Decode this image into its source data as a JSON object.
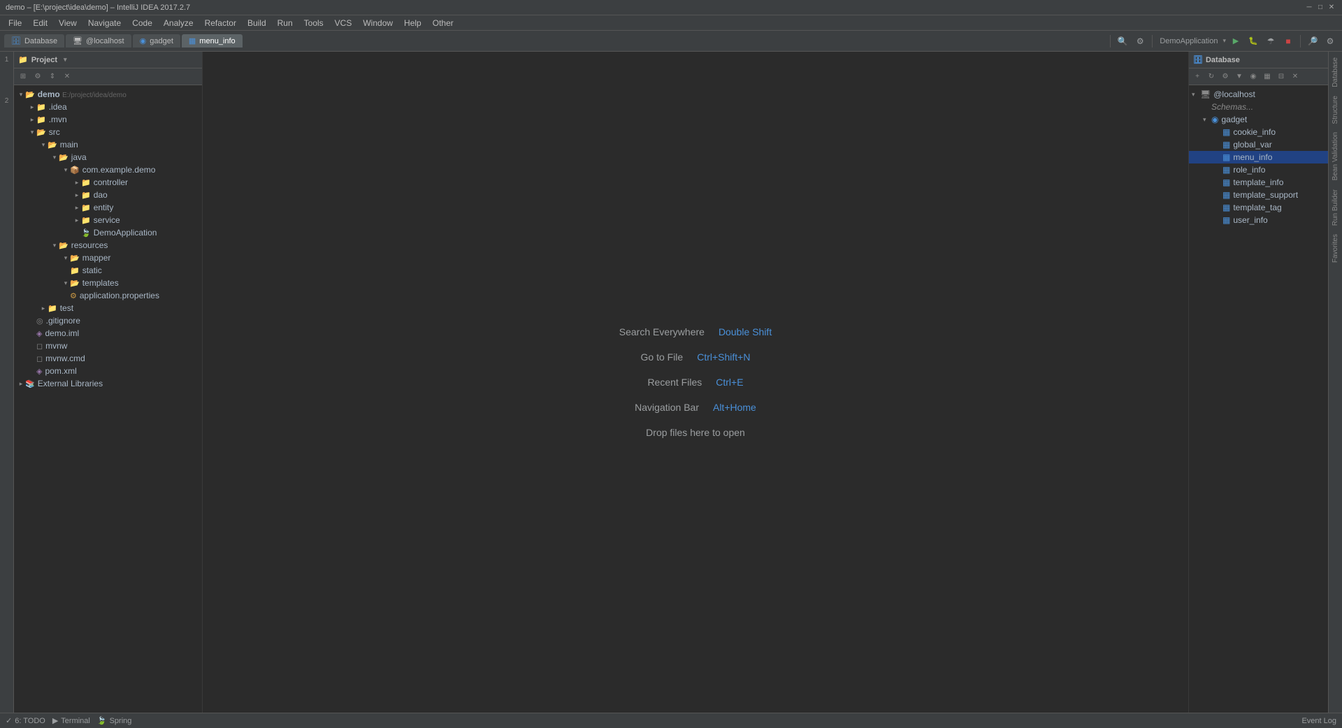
{
  "window": {
    "title": "demo – [E:\\project\\idea\\demo] – IntelliJ IDEA 2017.2.7",
    "controls": [
      "minimize",
      "maximize",
      "close"
    ]
  },
  "menu": {
    "items": [
      "File",
      "Edit",
      "View",
      "Navigate",
      "Code",
      "Analyze",
      "Refactor",
      "Build",
      "Run",
      "Tools",
      "VCS",
      "Window",
      "Help",
      "Other"
    ]
  },
  "tabs": [
    {
      "label": "Database",
      "icon": "db"
    },
    {
      "label": "@localhost",
      "icon": "server"
    },
    {
      "label": "gadget",
      "icon": "db"
    },
    {
      "label": "menu_info",
      "icon": "table"
    }
  ],
  "run_config": "DemoApplication",
  "project_panel": {
    "title": "Project",
    "tree": [
      {
        "indent": 0,
        "arrow": "▾",
        "icon": "folder",
        "label": "demo",
        "detail": "E:/project/idea/demo",
        "level": 0
      },
      {
        "indent": 1,
        "arrow": "▾",
        "icon": "folder",
        "label": ".idea",
        "level": 1
      },
      {
        "indent": 1,
        "arrow": "▾",
        "icon": "folder",
        "label": ".mvn",
        "level": 1
      },
      {
        "indent": 1,
        "arrow": "▾",
        "icon": "folder",
        "label": "src",
        "level": 1
      },
      {
        "indent": 2,
        "arrow": "▾",
        "icon": "folder",
        "label": "main",
        "level": 2
      },
      {
        "indent": 3,
        "arrow": "▾",
        "icon": "folder",
        "label": "java",
        "level": 3
      },
      {
        "indent": 4,
        "arrow": "▾",
        "icon": "package",
        "label": "com.example.demo",
        "level": 4
      },
      {
        "indent": 5,
        "arrow": "▾",
        "icon": "folder",
        "label": "controller",
        "level": 5
      },
      {
        "indent": 5,
        "arrow": "▾",
        "icon": "folder",
        "label": "dao",
        "level": 5
      },
      {
        "indent": 5,
        "arrow": "▾",
        "icon": "folder",
        "label": "entity",
        "level": 5
      },
      {
        "indent": 5,
        "arrow": "▸",
        "icon": "folder",
        "label": "service",
        "level": 5
      },
      {
        "indent": 5,
        "arrow": "·",
        "icon": "spring",
        "label": "DemoApplication",
        "level": 5
      },
      {
        "indent": 3,
        "arrow": "▾",
        "icon": "folder",
        "label": "resources",
        "level": 3
      },
      {
        "indent": 4,
        "arrow": "▾",
        "icon": "folder",
        "label": "mapper",
        "level": 4
      },
      {
        "indent": 4,
        "arrow": "·",
        "icon": "folder",
        "label": "static",
        "level": 4
      },
      {
        "indent": 4,
        "arrow": "▾",
        "icon": "folder",
        "label": "templates",
        "level": 4
      },
      {
        "indent": 4,
        "arrow": "·",
        "icon": "properties",
        "label": "application.properties",
        "level": 4
      },
      {
        "indent": 2,
        "arrow": "▸",
        "icon": "folder",
        "label": "test",
        "level": 2
      },
      {
        "indent": 1,
        "arrow": "·",
        "icon": "gitignore",
        "label": ".gitignore",
        "level": 1
      },
      {
        "indent": 1,
        "arrow": "·",
        "icon": "xml",
        "label": "demo.iml",
        "level": 1
      },
      {
        "indent": 1,
        "arrow": "·",
        "icon": "plain",
        "label": "mvnw",
        "level": 1
      },
      {
        "indent": 1,
        "arrow": "·",
        "icon": "plain",
        "label": "mvnw.cmd",
        "level": 1
      },
      {
        "indent": 1,
        "arrow": "·",
        "icon": "xml",
        "label": "pom.xml",
        "level": 1
      },
      {
        "indent": 0,
        "arrow": "▸",
        "icon": "folder",
        "label": "External Libraries",
        "level": 0
      }
    ]
  },
  "welcome": {
    "items": [
      {
        "label": "Search Everywhere",
        "shortcut": "Double Shift"
      },
      {
        "label": "Go to File",
        "shortcut": "Ctrl+Shift+N"
      },
      {
        "label": "Recent Files",
        "shortcut": "Ctrl+E"
      },
      {
        "label": "Navigation Bar",
        "shortcut": "Alt+Home"
      },
      {
        "label": "Drop files here to open",
        "shortcut": ""
      }
    ]
  },
  "database_panel": {
    "title": "Database",
    "tree": [
      {
        "indent": 0,
        "arrow": "▾",
        "type": "server",
        "label": "@localhost"
      },
      {
        "indent": 1,
        "arrow": "·",
        "type": "schema",
        "label": "Schemas..."
      },
      {
        "indent": 1,
        "arrow": "▾",
        "type": "db",
        "label": "gadget"
      },
      {
        "indent": 2,
        "arrow": "·",
        "type": "table",
        "label": "cookie_info"
      },
      {
        "indent": 2,
        "arrow": "·",
        "type": "table",
        "label": "global_var"
      },
      {
        "indent": 2,
        "arrow": "·",
        "type": "table",
        "label": "menu_info",
        "selected": true
      },
      {
        "indent": 2,
        "arrow": "·",
        "type": "table",
        "label": "role_info"
      },
      {
        "indent": 2,
        "arrow": "·",
        "type": "table",
        "label": "template_info"
      },
      {
        "indent": 2,
        "arrow": "·",
        "type": "table",
        "label": "template_support"
      },
      {
        "indent": 2,
        "arrow": "·",
        "type": "table",
        "label": "template_tag"
      },
      {
        "indent": 2,
        "arrow": "·",
        "type": "table",
        "label": "user_info"
      }
    ]
  },
  "bottom_bar": {
    "items": [
      {
        "icon": "check",
        "label": "6: TODO"
      },
      {
        "icon": "terminal",
        "label": "Terminal"
      },
      {
        "icon": "spring",
        "label": "Spring"
      }
    ],
    "right": "Event Log"
  },
  "right_panels": [
    "Database",
    "Structure",
    "Bean Validation",
    "Run Builder",
    "Favorites"
  ]
}
